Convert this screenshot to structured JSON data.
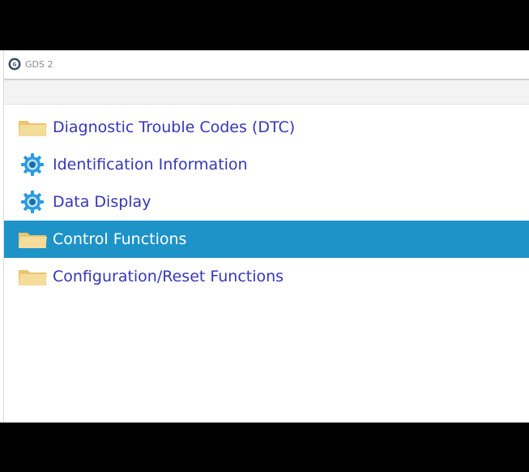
{
  "window": {
    "title": "GDS 2",
    "app_icon": "gds2-logo-icon"
  },
  "menu": {
    "items": [
      {
        "label": "Diagnostic Trouble Codes (DTC)",
        "icon": "folder-icon",
        "selected": false
      },
      {
        "label": "Identification Information",
        "icon": "gear-icon",
        "selected": false
      },
      {
        "label": "Data Display",
        "icon": "gear-icon",
        "selected": false
      },
      {
        "label": "Control Functions",
        "icon": "folder-icon",
        "selected": true
      },
      {
        "label": "Configuration/Reset Functions",
        "icon": "folder-icon",
        "selected": false
      }
    ]
  },
  "colors": {
    "selection": "#1e93c8",
    "link_text": "#3636b8",
    "folder": "#f2d58a",
    "gear": "#2a9be0"
  }
}
